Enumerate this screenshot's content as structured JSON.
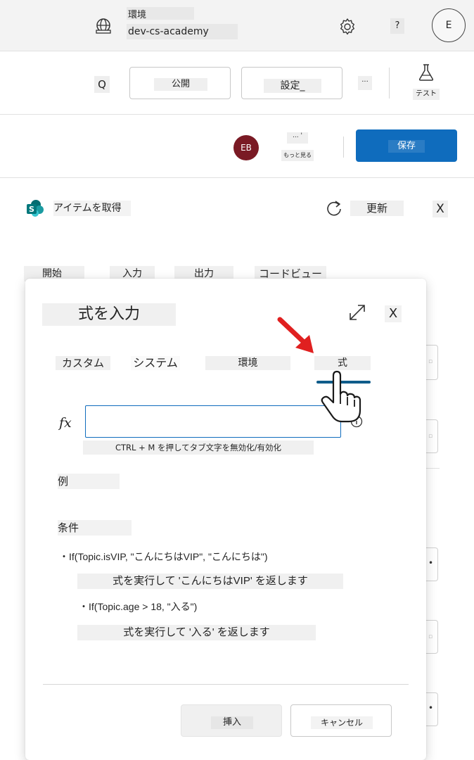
{
  "topbar": {
    "env_label": "環境",
    "env_name": "dev-cs-academy",
    "help_label": "?",
    "user_initial": "E"
  },
  "toolbar": {
    "search_label": "Q",
    "publish_label": "公開",
    "settings_label": "設定_",
    "more_label": "...",
    "test_label": "テスト"
  },
  "actionbar": {
    "avatar_initials": "EB",
    "more_label": "... '",
    "see_more_label": "もっと見る",
    "save_label": "保存"
  },
  "panel": {
    "title": "アイテムを取得",
    "refresh_label": "更新",
    "close_label": "X",
    "tabs": [
      "開始",
      "入力",
      "出力",
      "コードビュー"
    ]
  },
  "dialog": {
    "title": "式を入力",
    "close_label": "X",
    "tabs": [
      "カスタム",
      "システム",
      "環境",
      "式"
    ],
    "active_tab": "式",
    "fx_label": "fx",
    "formula_value": "",
    "hint": "CTRL + M を押してタブ文字を無効化/有効化",
    "example_heading": "例",
    "condition_heading": "条件",
    "examples": [
      "・If(Topic.isVIP, \"こんにちはVIP\", \"こんにちは\")",
      "式を実行して 'こんにちはVIP' を返します",
      "・If(Topic.age > 18, \"入る\")",
      "式を実行して '入る' を返します"
    ],
    "insert_label": "挿入",
    "cancel_label": "キャンセル"
  },
  "colors": {
    "primary": "#0f6cbd",
    "avatar_bg": "#7a1a24",
    "tab_underline": "#0f5c8a",
    "annotation_arrow": "#e02020"
  },
  "icons": [
    "globe-icon",
    "gear-icon",
    "flask-icon",
    "sharepoint-icon",
    "refresh-icon",
    "expand-icon",
    "info-icon",
    "arrow-annotation-icon",
    "hand-pointer-icon"
  ]
}
